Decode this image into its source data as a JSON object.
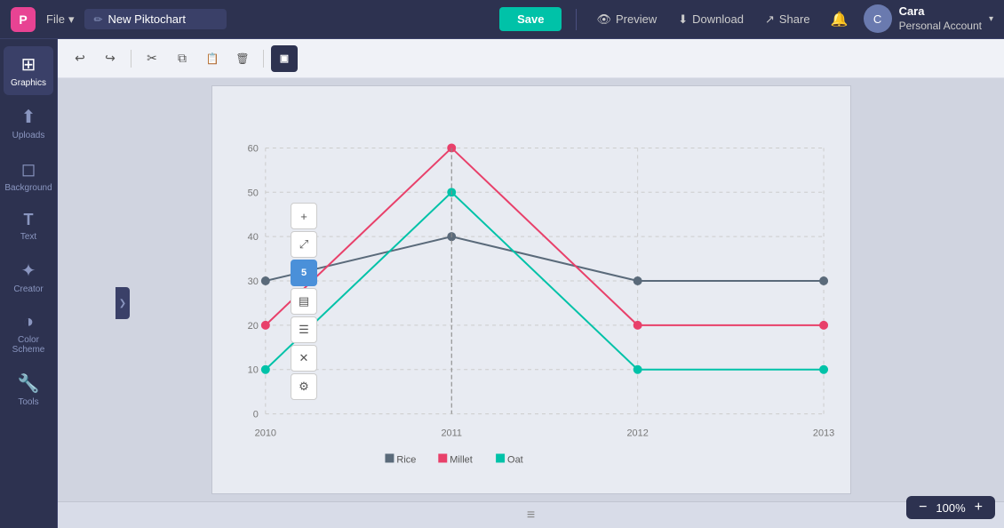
{
  "app": {
    "logo_text": "P",
    "file_menu": "File",
    "chart_title": "New Piktochart",
    "edit_icon": "✏"
  },
  "topbar": {
    "save_label": "Save",
    "preview_label": "Preview",
    "download_label": "Download",
    "share_label": "Share",
    "user_name": "Cara",
    "user_account": "Personal Account"
  },
  "sidebar": {
    "items": [
      {
        "id": "graphics",
        "label": "Graphics",
        "icon": "⊞",
        "active": true
      },
      {
        "id": "uploads",
        "label": "Uploads",
        "icon": "↑"
      },
      {
        "id": "background",
        "label": "Background",
        "icon": "◫"
      },
      {
        "id": "text",
        "label": "Text",
        "icon": "T"
      },
      {
        "id": "creator",
        "label": "Creator",
        "icon": "✦"
      },
      {
        "id": "color-scheme",
        "label": "Color Scheme",
        "icon": "◑"
      },
      {
        "id": "tools",
        "label": "Tools",
        "icon": "⚙"
      }
    ]
  },
  "toolbar": {
    "buttons": [
      {
        "id": "undo",
        "icon": "↩",
        "label": "Undo"
      },
      {
        "id": "redo",
        "icon": "↪",
        "label": "Redo"
      },
      {
        "id": "cut",
        "icon": "✂",
        "label": "Cut"
      },
      {
        "id": "copy",
        "icon": "⧉",
        "label": "Copy"
      },
      {
        "id": "paste",
        "icon": "📋",
        "label": "Paste"
      },
      {
        "id": "delete",
        "icon": "🗑",
        "label": "Delete"
      }
    ],
    "active_tool": "select"
  },
  "mini_tools": [
    {
      "id": "add",
      "icon": "+"
    },
    {
      "id": "resize",
      "icon": "⤢"
    },
    {
      "id": "num",
      "icon": "5",
      "type": "num"
    },
    {
      "id": "table",
      "icon": "▤"
    },
    {
      "id": "align",
      "icon": "☰"
    },
    {
      "id": "close",
      "icon": "✕"
    },
    {
      "id": "settings",
      "icon": "⚙"
    }
  ],
  "chart": {
    "y_labels": [
      "0",
      "10",
      "20",
      "30",
      "40",
      "50",
      "60"
    ],
    "x_labels": [
      "2010",
      "2011",
      "2012",
      "2013"
    ],
    "series": [
      {
        "name": "Rice",
        "color": "#5a6a7a",
        "points": [
          {
            "x": 0,
            "y": 30
          },
          {
            "x": 1,
            "y": 40
          },
          {
            "x": 2,
            "y": 30
          },
          {
            "x": 3,
            "y": 30
          }
        ]
      },
      {
        "name": "Millet",
        "color": "#e8406a",
        "points": [
          {
            "x": 0,
            "y": 20
          },
          {
            "x": 1,
            "y": 60
          },
          {
            "x": 2,
            "y": 20
          },
          {
            "x": 3,
            "y": 20
          }
        ]
      },
      {
        "name": "Oat",
        "color": "#00c2a8",
        "points": [
          {
            "x": 0,
            "y": 10
          },
          {
            "x": 1,
            "y": 50
          },
          {
            "x": 2,
            "y": 10
          },
          {
            "x": 3,
            "y": 10
          }
        ]
      }
    ],
    "legend": [
      {
        "name": "Rice",
        "color": "#5a6a7a"
      },
      {
        "name": "Millet",
        "color": "#e8406a"
      },
      {
        "name": "Oat",
        "color": "#00c2a8"
      }
    ]
  },
  "zoom": {
    "level": "100%",
    "minus": "−",
    "plus": "+"
  },
  "collapse_icon": "❯"
}
